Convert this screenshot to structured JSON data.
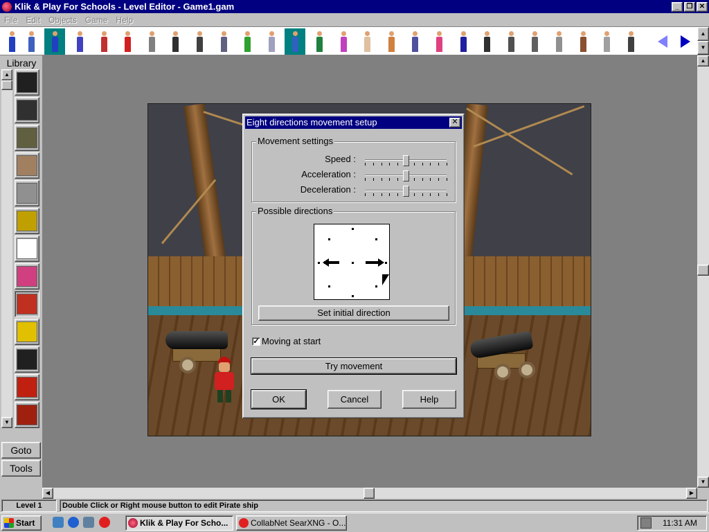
{
  "window": {
    "title": "Klik & Play For Schools - Level Editor - Game1.gam",
    "buttons": [
      "_",
      "❐",
      "✕"
    ]
  },
  "menu": [
    {
      "label": "File"
    },
    {
      "label": "Edit"
    },
    {
      "label": "Objects"
    },
    {
      "label": "Game"
    },
    {
      "label": "Help"
    }
  ],
  "library": {
    "label": "Library",
    "items": [
      {
        "name": "clapperboard-1",
        "color": "#202020"
      },
      {
        "name": "clapperboard-2",
        "color": "#303030"
      },
      {
        "name": "score-counter",
        "color": "#606040"
      },
      {
        "name": "building",
        "color": "#a08060"
      },
      {
        "name": "camera",
        "color": "#909090"
      },
      {
        "name": "key",
        "color": "#c0a000"
      },
      {
        "name": "smiley-face",
        "color": "#ffffff"
      },
      {
        "name": "flower",
        "color": "#d04080"
      },
      {
        "name": "clown",
        "color": "#c03020"
      },
      {
        "name": "king",
        "color": "#e0c000"
      },
      {
        "name": "witch",
        "color": "#202020"
      },
      {
        "name": "bug",
        "color": "#c02010"
      },
      {
        "name": "monster",
        "color": "#a02010"
      }
    ],
    "goto_label": "Goto",
    "tools_label": "Tools"
  },
  "toolbar": {
    "figures": [
      "#4040c0",
      "#c03030",
      "#d02020",
      "#808080",
      "#303030",
      "#404040",
      "#606080",
      "#30a030",
      "#a0a0c0",
      "#3060c0",
      "#208040",
      "#c040c0",
      "#e0c0a0",
      "#d08040",
      "#5050a0",
      "#e04080",
      "#2020a0",
      "#303030",
      "#505050",
      "#606060",
      "#909090",
      "#8a5030",
      "#a0a0a0",
      "#404040"
    ]
  },
  "dialog": {
    "title": "Eight directions movement setup",
    "close": "✕",
    "movement_group": "Movement settings",
    "sliders": [
      {
        "label": "Speed :",
        "value": 0.5
      },
      {
        "label": "Acceleration :",
        "value": 0.5
      },
      {
        "label": "Deceleration :",
        "value": 0.5
      }
    ],
    "directions_group": "Possible directions",
    "set_initial": "Set initial direction",
    "moving_at_start": "Moving at start",
    "moving_checked": "✓",
    "try_movement": "Try movement",
    "ok": "OK",
    "cancel": "Cancel",
    "help": "Help"
  },
  "status": {
    "level": "Level 1",
    "hint": "Double Click or Right mouse button to edit Pirate ship"
  },
  "taskbar": {
    "start": "Start",
    "tasks": [
      "Klik & Play For Scho...",
      "CollabNet SearXNG - O..."
    ],
    "clock": "11:31 AM"
  }
}
